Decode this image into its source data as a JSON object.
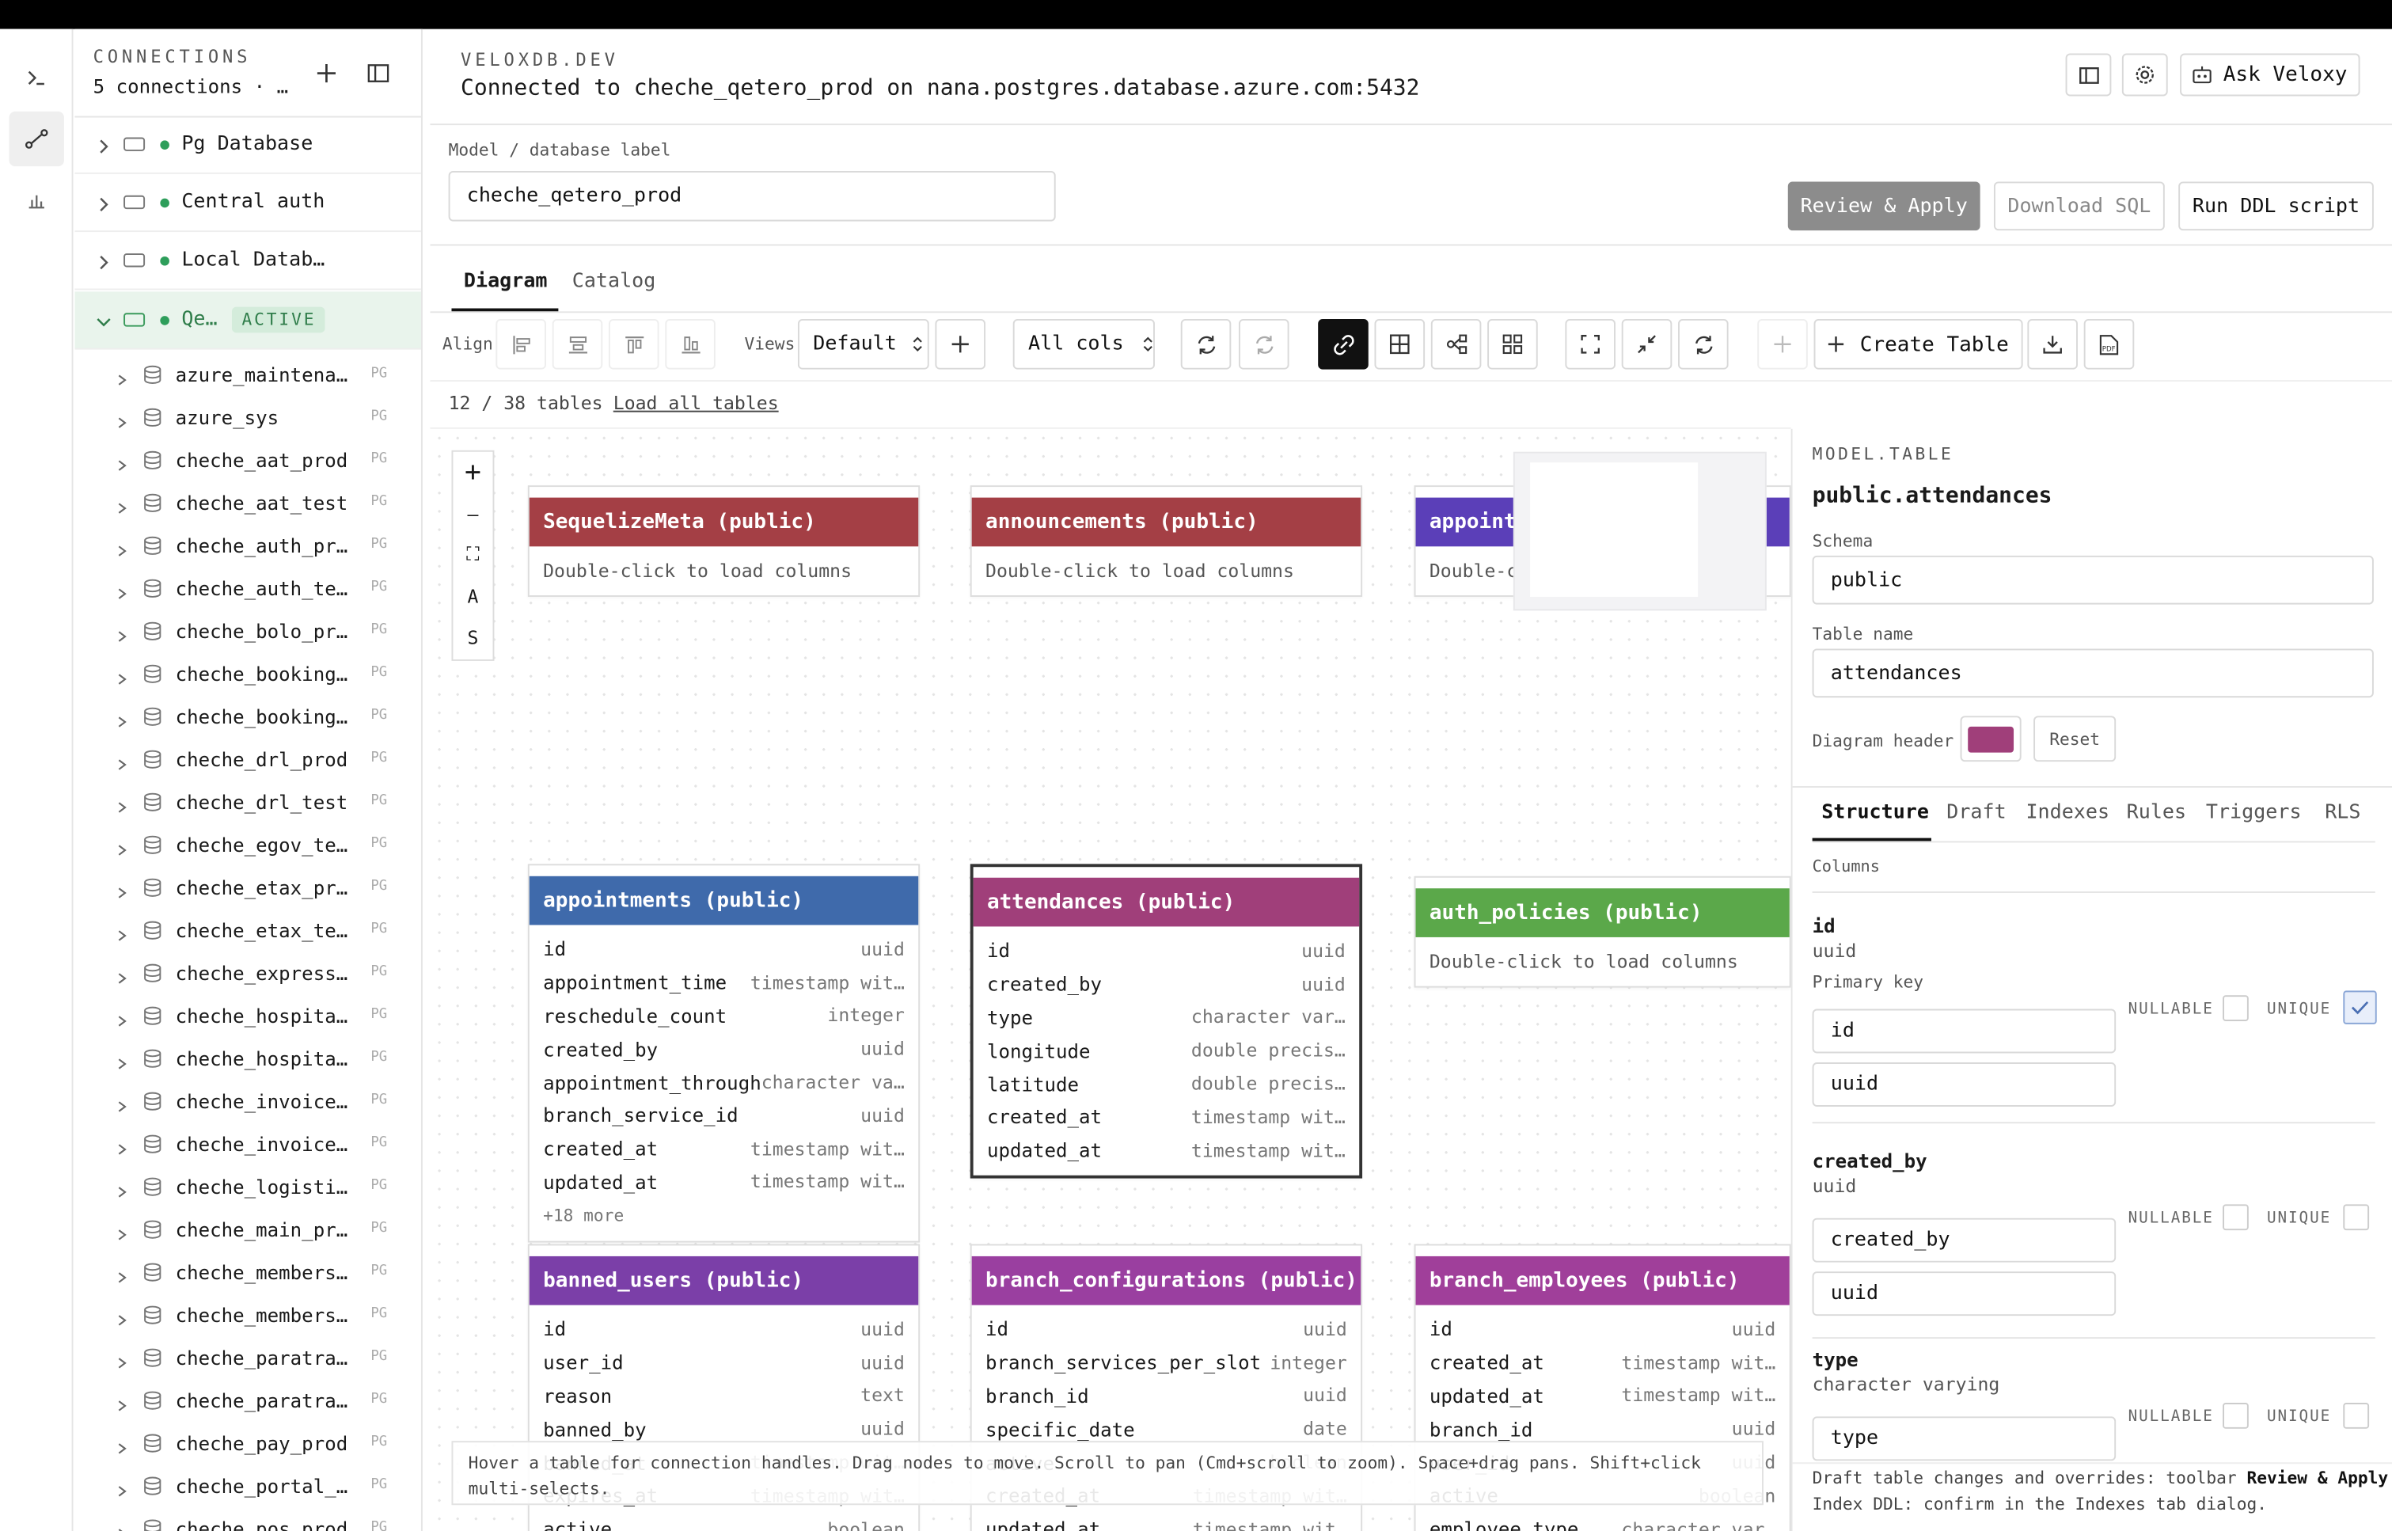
{
  "rail": {
    "icons": [
      "terminal-icon",
      "diagram-icon",
      "chart-icon"
    ]
  },
  "sidebar": {
    "eyebrow": "CONNECTIONS",
    "subtitle": "5 connections · …",
    "connections": [
      {
        "label": "Pg Database"
      },
      {
        "label": "Central auth"
      },
      {
        "label": "Local Datab…"
      },
      {
        "label": "Qe…",
        "badge": "ACTIVE"
      }
    ],
    "databases": [
      "azure_maintena…",
      "azure_sys",
      "cheche_aat_prod",
      "cheche_aat_test",
      "cheche_auth_pr…",
      "cheche_auth_te…",
      "cheche_bolo_pr…",
      "cheche_booking…",
      "cheche_booking…",
      "cheche_drl_prod",
      "cheche_drl_test",
      "cheche_egov_te…",
      "cheche_etax_pr…",
      "cheche_etax_te…",
      "cheche_express…",
      "cheche_hospita…",
      "cheche_hospita…",
      "cheche_invoice…",
      "cheche_invoice…",
      "cheche_logisti…",
      "cheche_main_pr…",
      "cheche_members…",
      "cheche_members…",
      "cheche_paratra…",
      "cheche_paratra…",
      "cheche_pay_prod",
      "cheche_portal_…",
      "cheche_pos_prod"
    ],
    "db_badge": "PG"
  },
  "header": {
    "brand": "VELOXDB.DEV",
    "status": "Connected to cheche_qetero_prod on nana.postgres.database.azure.com:5432",
    "ask_label": "Ask Veloxy"
  },
  "model": {
    "label": "Model / database label",
    "value": "cheche_qetero_prod",
    "review_label": "Review & Apply",
    "download_label": "Download SQL",
    "run_label": "Run DDL script"
  },
  "tabs": {
    "diagram": "Diagram",
    "catalog": "Catalog"
  },
  "toolbar": {
    "align_label": "Align",
    "views_label": "Views",
    "views_value": "Default",
    "cols_value": "All cols",
    "create_table": "Create Table"
  },
  "status": {
    "count": "12 / 38 tables",
    "load_all": "Load all tables"
  },
  "zoom_controls": [
    "+",
    "—",
    "⛶",
    "A",
    "S"
  ],
  "nodes": [
    {
      "title": "SequelizeMeta (public)",
      "color": "#a43f45",
      "hint": "Double-click to load columns"
    },
    {
      "title": "announcements (public)",
      "color": "#a43f45",
      "hint": "Double-click to load columns"
    },
    {
      "title": "appointm",
      "color": "#5b3fb8",
      "hint": "Double-c"
    },
    {
      "title": "appointments (public)",
      "color": "#3f6aab",
      "columns": [
        [
          "id",
          "uuid"
        ],
        [
          "appointment_time",
          "timestamp wit…"
        ],
        [
          "reschedule_count",
          "integer"
        ],
        [
          "created_by",
          "uuid"
        ],
        [
          "appointment_through",
          "character var…"
        ],
        [
          "branch_service_id",
          "uuid"
        ],
        [
          "created_at",
          "timestamp wit…"
        ],
        [
          "updated_at",
          "timestamp wit…"
        ]
      ],
      "more": "+18 more"
    },
    {
      "title": "attendances (public)",
      "color": "#a03f7a",
      "columns": [
        [
          "id",
          "uuid"
        ],
        [
          "created_by",
          "uuid"
        ],
        [
          "type",
          "character var…"
        ],
        [
          "longitude",
          "double precis…"
        ],
        [
          "latitude",
          "double precis…"
        ],
        [
          "created_at",
          "timestamp wit…"
        ],
        [
          "updated_at",
          "timestamp wit…"
        ]
      ]
    },
    {
      "title": "auth_policies (public)",
      "color": "#5ba84a",
      "hint": "Double-click to load columns"
    },
    {
      "title": "banned_users (public)",
      "color": "#7b3fa8",
      "columns": [
        [
          "id",
          "uuid"
        ],
        [
          "user_id",
          "uuid"
        ],
        [
          "reason",
          "text"
        ],
        [
          "banned_by",
          "uuid"
        ],
        [
          "banned_at",
          "timestamp wit…"
        ],
        [
          "expires_at",
          "timestamp wit…"
        ],
        [
          "active",
          "boolean"
        ]
      ]
    },
    {
      "title": "branch_configurations (public)",
      "color": "#9a3fa0",
      "columns": [
        [
          "id",
          "uuid"
        ],
        [
          "branch_services_per_slot",
          "integer"
        ],
        [
          "branch_id",
          "uuid"
        ],
        [
          "specific_date",
          "date"
        ],
        [
          "active",
          "boolean"
        ],
        [
          "created_at",
          "timestamp wit…"
        ],
        [
          "updated_at",
          "timestamp wit…"
        ]
      ]
    },
    {
      "title": "branch_employees (public)",
      "color": "#a03f9a",
      "columns": [
        [
          "id",
          "uuid"
        ],
        [
          "created_at",
          "timestamp wit…"
        ],
        [
          "updated_at",
          "timestamp wit…"
        ],
        [
          "branch_id",
          "uuid"
        ],
        [
          "user_id",
          "uuid"
        ],
        [
          "active",
          "boolean"
        ],
        [
          "employee_type",
          "character var…"
        ]
      ]
    }
  ],
  "hint_text": "Hover a table for connection handles. Drag nodes to move. Scroll to pan (Cmd+scroll to zoom). Space+drag pans. Shift+click multi-selects.",
  "panel": {
    "eyebrow": "MODEL.TABLE",
    "title": "public.attendances",
    "schema_label": "Schema",
    "schema_value": "public",
    "table_label": "Table name",
    "table_value": "attendances",
    "header_label": "Diagram header",
    "header_color": "#a03f7a",
    "reset_label": "Reset",
    "tabs": [
      "Structure",
      "Draft",
      "Indexes",
      "Rules",
      "Triggers",
      "RLS"
    ],
    "columns_label": "Columns",
    "nullable_label": "NULLABLE",
    "unique_label": "UNIQUE",
    "pk_label": "Primary key",
    "columns": [
      {
        "name": "id",
        "type": "uuid",
        "name_value": "id",
        "type_value": "uuid",
        "unique": true
      },
      {
        "name": "created_by",
        "type": "uuid",
        "name_value": "created_by",
        "type_value": "uuid",
        "unique": false
      },
      {
        "name": "type",
        "type": "character varying",
        "name_value": "type",
        "unique": false
      }
    ],
    "footer_pre": "Draft table changes and overrides: toolbar ",
    "footer_kw": "Review & Apply",
    "footer_post": ".",
    "footer_line2": "Index DDL: confirm in the Indexes tab dialog."
  }
}
